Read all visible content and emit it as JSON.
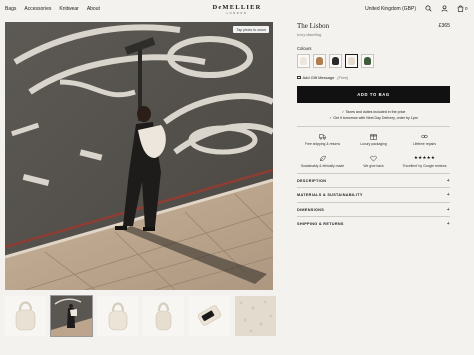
{
  "header": {
    "nav": [
      "Bags",
      "Accessories",
      "Knitwear",
      "About"
    ],
    "brand": "DeMELLIER",
    "brand_sub": "LONDON",
    "region": "United Kingdom (GBP)",
    "icons": [
      "search-icon",
      "user-icon",
      "cart-icon"
    ],
    "cart_count": "0"
  },
  "gallery": {
    "zoom_badge": "Tap photo to zoom"
  },
  "product": {
    "title": "The Lisbon",
    "subtitle": "ivory shearling",
    "price": "£365",
    "colours_label": "Colours",
    "colours": [
      "#ece6dc",
      "#b07d4e",
      "#2a2a2a",
      "#e4ddcf",
      "#3e5a3a"
    ],
    "selected_colour_index": 3,
    "gift_label": "Add Gift Message",
    "gift_free": "(Free)",
    "add_button": "ADD TO BAG",
    "notes": [
      "Taxes and duties included in the price",
      "Get it tomorrow with Next Day Delivery, order by 1pm"
    ],
    "features": [
      {
        "icon": "truck-icon",
        "text": "Free shipping & returns"
      },
      {
        "icon": "gift-box-icon",
        "text": "Luxury packaging"
      },
      {
        "icon": "repair-icon",
        "text": "Lifetime repairs"
      },
      {
        "icon": "leaf-icon",
        "text": "Sustainably & ethically made"
      },
      {
        "icon": "heart-icon",
        "text": "We give back"
      },
      {
        "icon": "stars-icon",
        "text": "'Excellent' by Google reviews",
        "stars": "★★★★★"
      }
    ],
    "accordion": [
      "DESCRIPTION",
      "MATERIALS & SUSTAINABILITY",
      "DIMENSIONS",
      "SHIPPING & RETURNS"
    ]
  }
}
